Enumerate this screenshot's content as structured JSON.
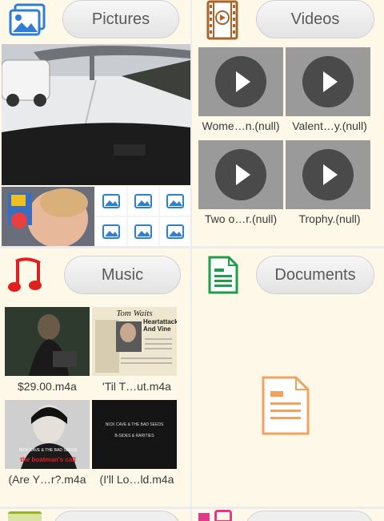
{
  "sections": {
    "pictures": {
      "label": "Pictures"
    },
    "videos": {
      "label": "Videos",
      "items": [
        {
          "caption": "Wome…n.(null)"
        },
        {
          "caption": "Valent…y.(null)"
        },
        {
          "caption": "Two o…r.(null)"
        },
        {
          "caption": "Trophy.(null)"
        }
      ]
    },
    "music": {
      "label": "Music",
      "items": [
        {
          "caption": "$29.00.m4a"
        },
        {
          "caption": "'Til T…ut.m4a",
          "album_title": "Tom Waits",
          "album_sub": "Heartattack And Vine"
        },
        {
          "caption": "(Are Y…r?.m4a",
          "album_text": "NICK CAVE & THE BAD SEEDS",
          "album_sub": "the boatman's call"
        },
        {
          "caption": "(I'll Lo…ld.m4a",
          "album_text": "NICK CAVE & THE BAD SEEDS",
          "album_sub": "B-SIDES & RARITIES"
        }
      ]
    },
    "documents": {
      "label": "Documents"
    }
  },
  "colors": {
    "background": "#fdf8e7",
    "pictures_icon": "#2f7ed6",
    "videos_icon": "#a8642a",
    "music_icon": "#e02020",
    "documents_icon": "#1e9e4a",
    "doc_placeholder": "#f2a25a"
  }
}
